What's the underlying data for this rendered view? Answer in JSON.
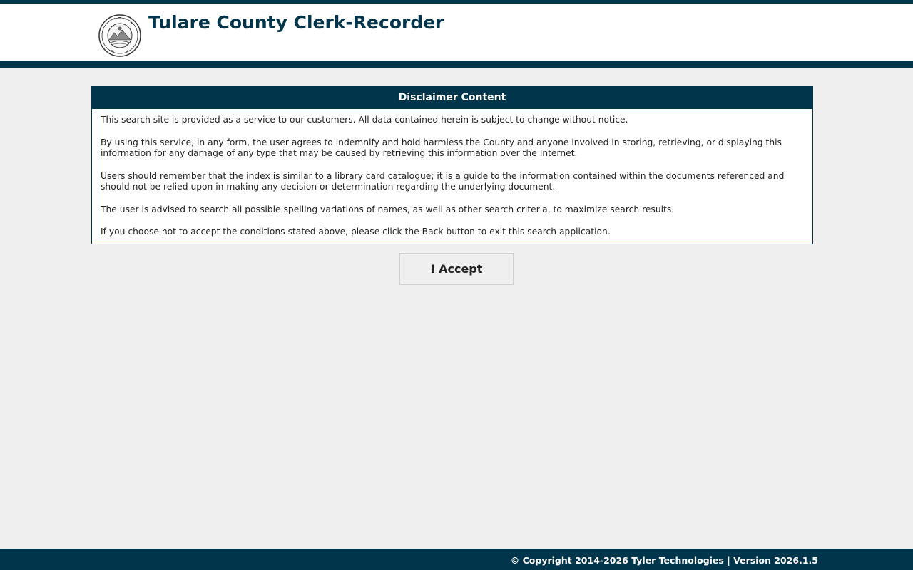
{
  "header": {
    "title": "Tulare County Clerk-Recorder",
    "logo_icon": "county-seal-icon",
    "brand_color": "#00354b"
  },
  "disclaimer": {
    "heading": "Disclaimer Content",
    "paragraphs": [
      "This search site is provided as a service to our customers. All data contained herein is subject to change without notice.",
      "By using this service, in any form, the user agrees to indemnify and hold harmless the County and anyone involved in storing, retrieving, or displaying this information for any damage of any type that may be caused by retrieving this information over the Internet.",
      "Users should remember that the index is similar to a library card catalogue; it is a guide to the information contained within the documents referenced and should not be relied upon in making any decision or determination regarding the underlying document.",
      "The user is advised to search all possible spelling variations of names, as well as other search criteria, to maximize search results.",
      "If you choose not to accept the conditions stated above, please click the Back button to exit this search application."
    ]
  },
  "actions": {
    "accept_label": "I Accept"
  },
  "footer": {
    "text": "© Copyright 2014-2026 Tyler Technologies | Version 2026.1.5"
  }
}
